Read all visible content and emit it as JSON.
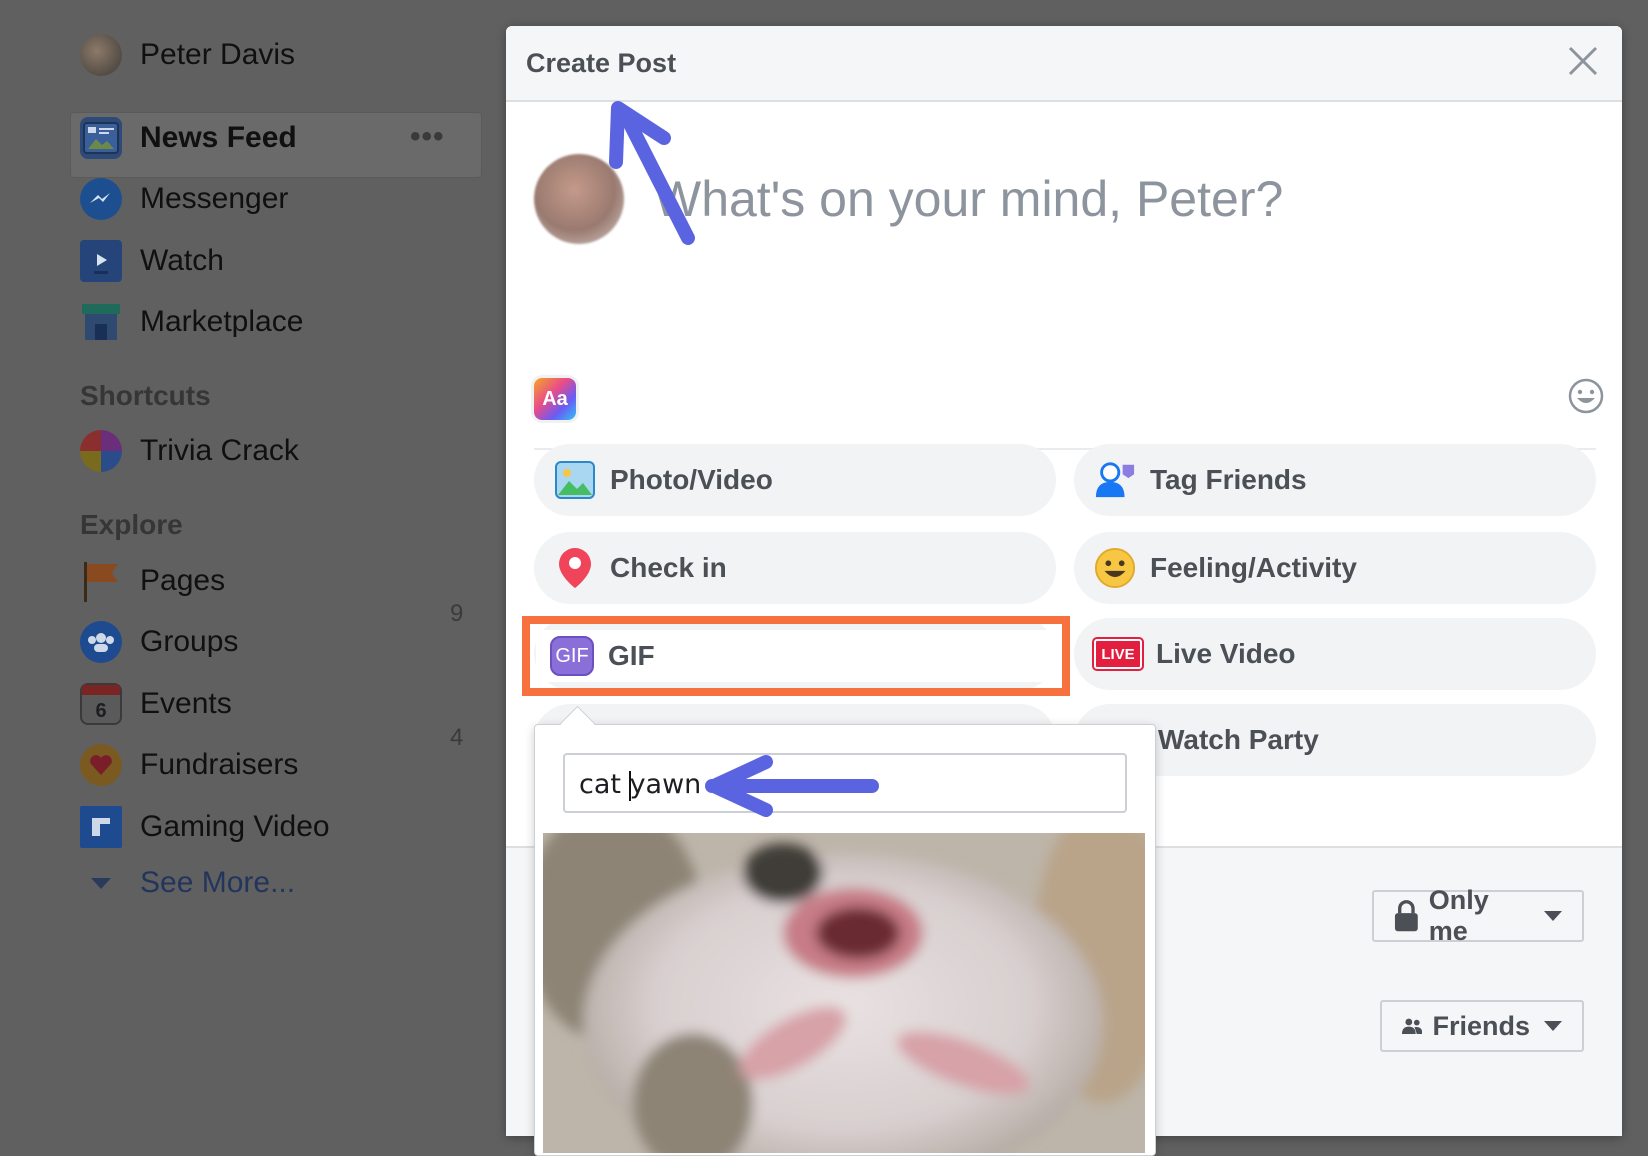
{
  "sidebar": {
    "profile_name": "Peter Davis",
    "items": [
      {
        "label": "News Feed",
        "icon": "news-feed-icon",
        "more": "•••"
      },
      {
        "label": "Messenger",
        "icon": "messenger-icon"
      },
      {
        "label": "Watch",
        "icon": "watch-icon"
      },
      {
        "label": "Marketplace",
        "icon": "marketplace-icon"
      }
    ],
    "shortcuts_heading": "Shortcuts",
    "shortcuts": [
      {
        "label": "Trivia Crack",
        "icon": "trivia-crack-icon"
      }
    ],
    "explore_heading": "Explore",
    "explore": [
      {
        "label": "Pages",
        "icon": "flag-icon",
        "count": "9"
      },
      {
        "label": "Groups",
        "icon": "groups-icon"
      },
      {
        "label": "Events",
        "icon": "calendar-icon",
        "count": "4",
        "calendar_day": "6"
      },
      {
        "label": "Fundraisers",
        "icon": "fundraiser-icon"
      },
      {
        "label": "Gaming Video",
        "icon": "gaming-video-icon"
      }
    ],
    "see_more": "See More..."
  },
  "modal": {
    "title": "Create Post",
    "placeholder": "What's on your mind, Peter?",
    "text_format_label": "Aa",
    "options": [
      {
        "label": "Photo/Video",
        "icon": "photo-video-icon"
      },
      {
        "label": "Tag Friends",
        "icon": "tag-friends-icon"
      },
      {
        "label": "Check in",
        "icon": "location-pin-icon"
      },
      {
        "label": "Feeling/Activity",
        "icon": "smiley-icon"
      },
      {
        "label": "GIF",
        "icon": "gif-icon",
        "badge": "GIF"
      },
      {
        "label": "Live Video",
        "icon": "live-video-icon",
        "badge": "LIVE"
      },
      {
        "label": "Watch Party",
        "icon": "watch-party-icon"
      }
    ],
    "privacy_primary": "Only me",
    "privacy_secondary": "Friends"
  },
  "gif_picker": {
    "search_before_caret": "cat ",
    "search_after_caret": "yawn"
  },
  "colors": {
    "highlight": "#f7713e",
    "annotation_arrow": "#5b64e0",
    "link": "#385898"
  }
}
